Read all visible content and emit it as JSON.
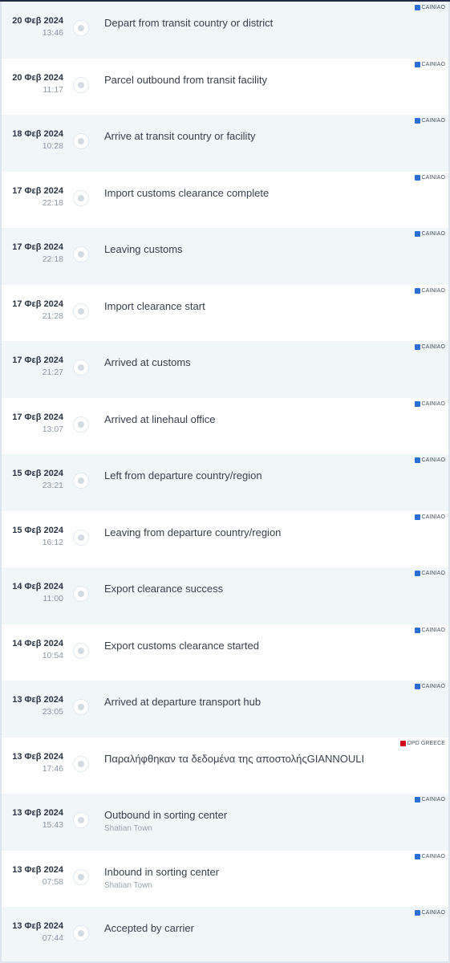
{
  "colors": {
    "cainiao": "#2a6fd6",
    "dpd": "#d0021b"
  },
  "events": [
    {
      "date": "20 Φεβ 2024",
      "time": "13:46",
      "status": "Depart from transit country or district",
      "location": "",
      "carrier": "CAINIAO",
      "carrier_icon": "cainiao-logo-icon"
    },
    {
      "date": "20 Φεβ 2024",
      "time": "11:17",
      "status": "Parcel outbound from transit facility",
      "location": "",
      "carrier": "CAINIAO",
      "carrier_icon": "cainiao-logo-icon"
    },
    {
      "date": "18 Φεβ 2024",
      "time": "10:28",
      "status": "Arrive at transit country or facility",
      "location": "",
      "carrier": "CAINIAO",
      "carrier_icon": "cainiao-logo-icon"
    },
    {
      "date": "17 Φεβ 2024",
      "time": "22:18",
      "status": "Import customs clearance complete",
      "location": "",
      "carrier": "CAINIAO",
      "carrier_icon": "cainiao-logo-icon"
    },
    {
      "date": "17 Φεβ 2024",
      "time": "22:18",
      "status": "Leaving customs",
      "location": "",
      "carrier": "CAINIAO",
      "carrier_icon": "cainiao-logo-icon"
    },
    {
      "date": "17 Φεβ 2024",
      "time": "21:28",
      "status": "Import clearance start",
      "location": "",
      "carrier": "CAINIAO",
      "carrier_icon": "cainiao-logo-icon"
    },
    {
      "date": "17 Φεβ 2024",
      "time": "21:27",
      "status": "Arrived at customs",
      "location": "",
      "carrier": "CAINIAO",
      "carrier_icon": "cainiao-logo-icon"
    },
    {
      "date": "17 Φεβ 2024",
      "time": "13:07",
      "status": "Arrived at linehaul office",
      "location": "",
      "carrier": "CAINIAO",
      "carrier_icon": "cainiao-logo-icon"
    },
    {
      "date": "15 Φεβ 2024",
      "time": "23:21",
      "status": "Left from departure country/region",
      "location": "",
      "carrier": "CAINIAO",
      "carrier_icon": "cainiao-logo-icon"
    },
    {
      "date": "15 Φεβ 2024",
      "time": "16:12",
      "status": "Leaving from departure country/region",
      "location": "",
      "carrier": "CAINIAO",
      "carrier_icon": "cainiao-logo-icon"
    },
    {
      "date": "14 Φεβ 2024",
      "time": "11:00",
      "status": "Export clearance success",
      "location": "",
      "carrier": "CAINIAO",
      "carrier_icon": "cainiao-logo-icon"
    },
    {
      "date": "14 Φεβ 2024",
      "time": "10:54",
      "status": "Export customs clearance started",
      "location": "",
      "carrier": "CAINIAO",
      "carrier_icon": "cainiao-logo-icon"
    },
    {
      "date": "13 Φεβ 2024",
      "time": "23:05",
      "status": "Arrived at departure transport hub",
      "location": "",
      "carrier": "CAINIAO",
      "carrier_icon": "cainiao-logo-icon"
    },
    {
      "date": "13 Φεβ 2024",
      "time": "17:46",
      "status": "Παραλήφθηκαν τα δεδομένα της αποστολήςGIANNOULI",
      "location": "",
      "carrier": "DPD GREECE",
      "carrier_icon": "dpd-logo-icon"
    },
    {
      "date": "13 Φεβ 2024",
      "time": "15:43",
      "status": "Outbound in sorting center",
      "location": "Shatian Town",
      "carrier": "CAINIAO",
      "carrier_icon": "cainiao-logo-icon"
    },
    {
      "date": "13 Φεβ 2024",
      "time": "07:58",
      "status": "Inbound in sorting center",
      "location": "Shatian Town",
      "carrier": "CAINIAO",
      "carrier_icon": "cainiao-logo-icon"
    },
    {
      "date": "13 Φεβ 2024",
      "time": "07:44",
      "status": "Accepted by carrier",
      "location": "",
      "carrier": "CAINIAO",
      "carrier_icon": "cainiao-logo-icon"
    }
  ]
}
